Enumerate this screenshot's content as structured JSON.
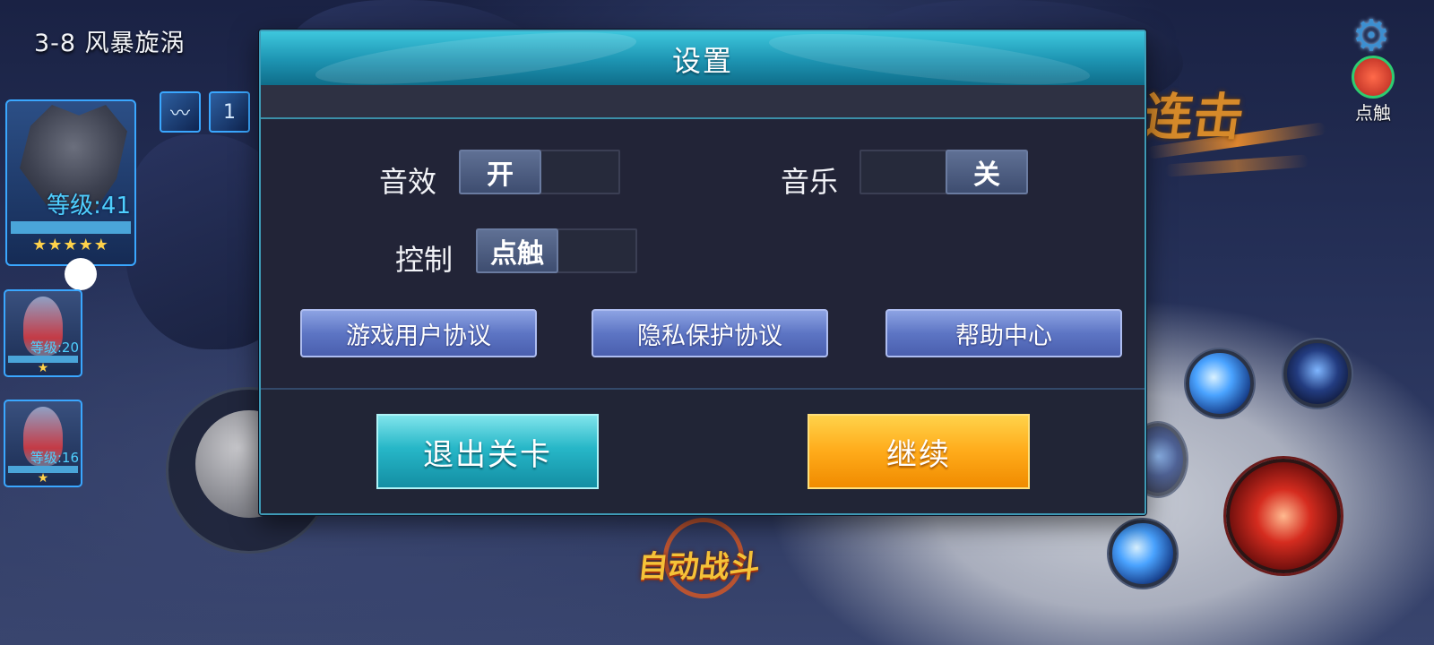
{
  "hud": {
    "stage_title": "3-8 风暴旋涡",
    "main_hero": {
      "level": "等级:41",
      "stars": "★★★★★"
    },
    "heroes": [
      {
        "level": "等级:20",
        "stars": "★"
      },
      {
        "level": "等级:16",
        "stars": "★"
      }
    ],
    "buffs": [
      "",
      "1"
    ],
    "touch_label": "点触",
    "combo_text": "连击",
    "auto_battle": "自动战斗"
  },
  "dialog": {
    "title": "设置",
    "sound": {
      "label": "音效",
      "value": "开"
    },
    "music": {
      "label": "音乐",
      "value": "关"
    },
    "control": {
      "label": "控制",
      "value": "点触"
    },
    "links": [
      "游戏用户协议",
      "隐私保护协议",
      "帮助中心"
    ],
    "exit_button": "退出关卡",
    "continue_button": "继续"
  },
  "icons": {
    "settings": "gear-icon",
    "touch": "touch-icon"
  },
  "colors": {
    "dialog_header": "#1d93b1",
    "link_button": "#5d75c4",
    "exit_button": "#27b7c8",
    "continue_button": "#ffab1a"
  }
}
